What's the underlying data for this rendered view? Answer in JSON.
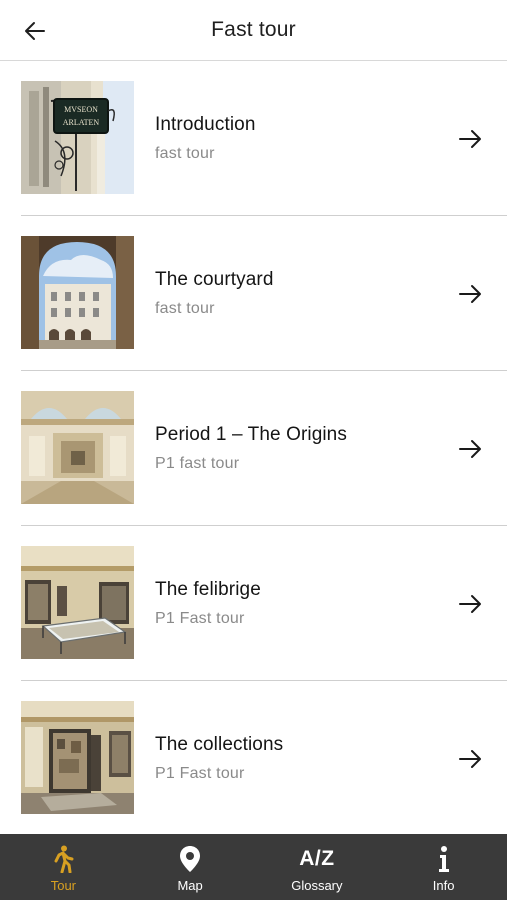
{
  "header": {
    "title": "Fast tour",
    "back_icon": "arrow-left-icon"
  },
  "items": [
    {
      "title": "Introduction",
      "subtitle": "fast tour",
      "thumb": "museum-sign-photo"
    },
    {
      "title": "The courtyard",
      "subtitle": "fast tour",
      "thumb": "courtyard-photo"
    },
    {
      "title": "Period 1 – The Origins",
      "subtitle": "P1 fast tour",
      "thumb": "gallery-room-photo"
    },
    {
      "title": "The felibrige",
      "subtitle": "P1 Fast tour",
      "thumb": "display-case-room-photo"
    },
    {
      "title": "The collections",
      "subtitle": "P1 Fast tour",
      "thumb": "collection-cabinet-photo"
    }
  ],
  "sign_text": {
    "line1": "MVSEON",
    "line2": "ARLATEN"
  },
  "tabbar": {
    "tabs": [
      {
        "label": "Tour",
        "icon": "walking-person-icon",
        "active": true
      },
      {
        "label": "Map",
        "icon": "map-pin-icon",
        "active": false
      },
      {
        "label": "Glossary",
        "icon": "az-text-icon",
        "icon_text": "A/Z",
        "active": false
      },
      {
        "label": "Info",
        "icon": "info-icon",
        "active": false
      }
    ]
  },
  "colors": {
    "accent": "#d8a022",
    "tabbar_bg": "#3a3a3a",
    "subtitle": "#8a8a8a",
    "divider": "#cfcfcf"
  }
}
